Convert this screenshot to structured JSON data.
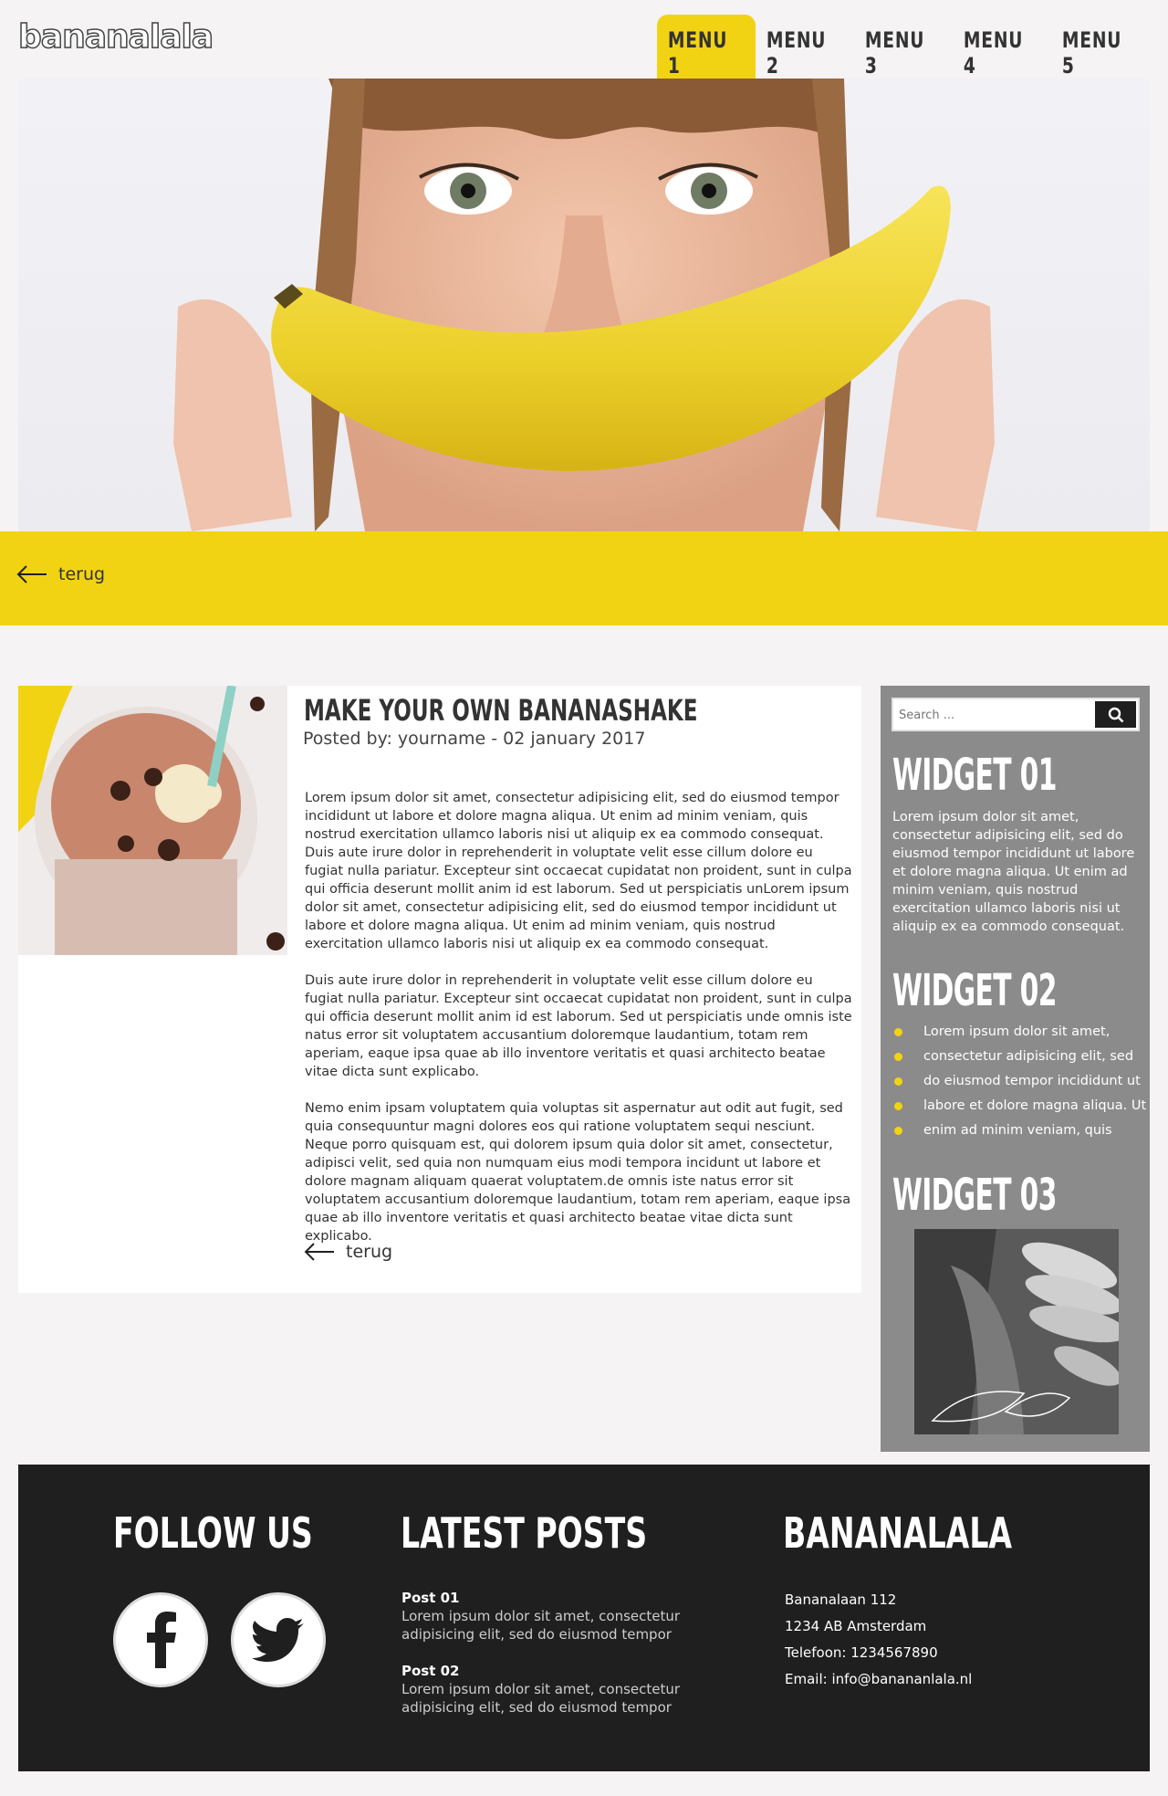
{
  "header": {
    "logo": "bananalala",
    "menu": [
      "MENU 1",
      "MENU 2",
      "MENU 3",
      "MENU 4",
      "MENU 5"
    ],
    "active_index": 0
  },
  "band": {
    "back_label": "terug"
  },
  "article": {
    "title": "MAKE YOUR OWN BANANASHAKE",
    "meta": "Posted by: yourname - 02 january 2017",
    "paragraphs": [
      "Lorem ipsum dolor sit amet, consectetur adipisicing elit, sed do eiusmod tempor incididunt ut labore et dolore magna aliqua. Ut enim ad minim veniam, quis nostrud exercitation ullamco laboris nisi ut aliquip ex ea commodo consequat. Duis aute irure dolor in reprehenderit in voluptate velit esse cillum dolore eu fugiat nulla pariatur. Excepteur sint occaecat cupidatat non proident, sunt in culpa qui officia deserunt mollit anim id est laborum. Sed ut perspiciatis unLorem ipsum dolor sit amet, consectetur adipisicing elit, sed do eiusmod tempor incididunt ut labore et dolore magna aliqua. Ut enim ad minim veniam, quis nostrud exercitation ullamco laboris nisi ut aliquip ex ea commodo consequat.",
      "Duis aute irure dolor in reprehenderit in voluptate velit esse cillum dolore eu fugiat nulla pariatur. Excepteur sint occaecat cupidatat non proident, sunt in culpa qui officia deserunt mollit anim id est laborum. Sed ut perspiciatis unde omnis iste natus error sit voluptatem accusantium doloremque laudantium, totam rem aperiam, eaque ipsa quae ab illo inventore veritatis et quasi architecto beatae vitae dicta sunt explicabo.",
      "Nemo enim ipsam voluptatem quia voluptas sit aspernatur aut odit aut fugit, sed quia consequuntur magni dolores eos qui ratione voluptatem sequi nesciunt. Neque porro quisquam est, qui dolorem ipsum quia dolor sit amet, consectetur, adipisci velit, sed quia non numquam eius modi tempora incidunt ut labore et dolore magnam aliquam quaerat voluptatem.de omnis iste natus error sit voluptatem accusantium doloremque laudantium, totam rem aperiam, eaque ipsa quae ab illo inventore veritatis et quasi architecto beatae vitae dicta sunt explicabo."
    ],
    "back_label": "terug"
  },
  "sidebar": {
    "search_placeholder": "Search ...",
    "widget1": {
      "title": "WIDGET 01",
      "text": "Lorem ipsum dolor sit amet, consectetur adipisicing elit, sed do eiusmod tempor incididunt ut labore et dolore magna aliqua. Ut enim ad minim veniam, quis nostrud exercitation ullamco laboris nisi ut aliquip ex ea commodo consequat."
    },
    "widget2": {
      "title": "WIDGET 02",
      "items": [
        "Lorem ipsum dolor sit amet,",
        "consectetur adipisicing elit, sed",
        "do eiusmod tempor incididunt ut",
        "labore et dolore magna aliqua. Ut",
        "enim ad minim veniam, quis"
      ]
    },
    "widget3": {
      "title": "WIDGET 03"
    }
  },
  "footer": {
    "follow_title": "FOLLOW US",
    "posts_title": "LATEST POSTS",
    "posts": [
      {
        "title": "Post 01",
        "text": "Lorem ipsum dolor sit amet, consectetur adipisicing elit, sed do eiusmod tempor"
      },
      {
        "title": "Post 02",
        "text": "Lorem ipsum dolor sit amet, consectetur adipisicing elit, sed do eiusmod tempor"
      }
    ],
    "brand_title": "BANANALALA",
    "contact": [
      "Bananalaan 112",
      "1234 AB Amsterdam",
      "Telefoon: 1234567890",
      "Email: info@banananlala.nl"
    ]
  },
  "colors": {
    "accent": "#f2d314",
    "dark": "#1f1f1f",
    "sidebar": "#8c8b8c",
    "page": "#f5f3f3"
  }
}
